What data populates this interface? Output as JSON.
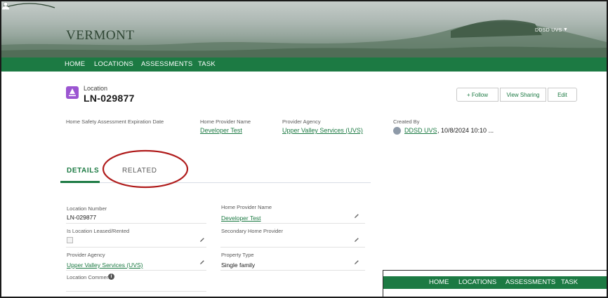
{
  "header": {
    "logo_text": "VERMONT",
    "user_name": "DDSD UVS",
    "bell_icon": "bell-icon",
    "user_icon": "user-icon"
  },
  "nav": {
    "items": [
      "HOME",
      "LOCATIONS",
      "ASSESSMENTS",
      "TASK"
    ]
  },
  "record": {
    "object_type": "Location",
    "name": "LN-029877",
    "icon": "location-icon",
    "icon_color": "#9b55d1",
    "buttons": {
      "follow": "+ Follow",
      "view_sharing": "View Sharing",
      "edit": "Edit"
    }
  },
  "highlights": [
    {
      "label": "Home Safety Assessment Expiration Date",
      "value": ""
    },
    {
      "label": "Home Provider Name",
      "value": "Developer Test"
    },
    {
      "label": "Provider Agency",
      "value": "Upper Valley Services (UVS)"
    },
    {
      "label": "Created By",
      "value": "DDSD UVS",
      "suffix": ", 10/8/2024 10:10 ..."
    }
  ],
  "tabs": {
    "details": "DETAILS",
    "related": "RELATED",
    "active": "DETAILS"
  },
  "fields": {
    "location_number": {
      "label": "Location Number",
      "value": "LN-029877"
    },
    "home_provider_name": {
      "label": "Home Provider Name",
      "value": "Developer Test"
    },
    "is_leased": {
      "label": "Is Location Leased/Rented",
      "checked": false
    },
    "secondary_home_provider": {
      "label": "Secondary Home Provider",
      "value": ""
    },
    "provider_agency": {
      "label": "Provider Agency",
      "value": "Upper Valley Services (UVS)"
    },
    "property_type": {
      "label": "Property Type",
      "value": "Single family"
    },
    "location_comments": {
      "label": "Location Comments"
    }
  },
  "inset_nav": {
    "items": [
      "HOME",
      "LOCATIONS",
      "ASSESSMENTS",
      "TASK"
    ]
  },
  "colors": {
    "accent": "#1c7a43",
    "annotation": "#b01c1c"
  }
}
